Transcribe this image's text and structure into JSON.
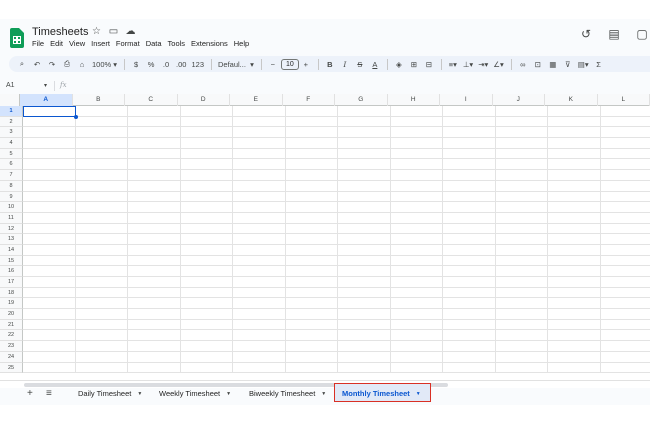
{
  "doc": {
    "title": "Timesheets"
  },
  "menu": [
    "File",
    "Edit",
    "View",
    "Insert",
    "Format",
    "Data",
    "Tools",
    "Extensions",
    "Help"
  ],
  "toolbar": {
    "zoom": "100%",
    "currency": "$",
    "percent": "%",
    "dec_decrease": ".0",
    "dec_increase": ".00",
    "format_123": "123",
    "font": "Defaul...",
    "font_size": "10",
    "bold": "B",
    "italic": "I",
    "text_color": "A"
  },
  "formula_bar": {
    "name_box": "A1",
    "fx": "fx"
  },
  "grid": {
    "columns": [
      "A",
      "B",
      "C",
      "D",
      "E",
      "F",
      "G",
      "H",
      "I",
      "J",
      "K",
      "L"
    ],
    "rows": [
      "1",
      "2",
      "3",
      "4",
      "5",
      "6",
      "7",
      "8",
      "9",
      "10",
      "11",
      "12",
      "13",
      "14",
      "15",
      "16",
      "17",
      "18",
      "19",
      "20",
      "21",
      "22",
      "23",
      "24",
      "25"
    ],
    "selected_cell": "A1"
  },
  "sheets": [
    {
      "label": "Daily Timesheet",
      "active": false
    },
    {
      "label": "Weekly Timesheet",
      "active": false
    },
    {
      "label": "Biweekly Timesheet",
      "active": false
    },
    {
      "label": "Monthly Timesheet",
      "active": true
    }
  ],
  "colors": {
    "accent": "#0b57d0",
    "sheets_green": "#0f9d58",
    "highlight_border": "#d93025"
  }
}
